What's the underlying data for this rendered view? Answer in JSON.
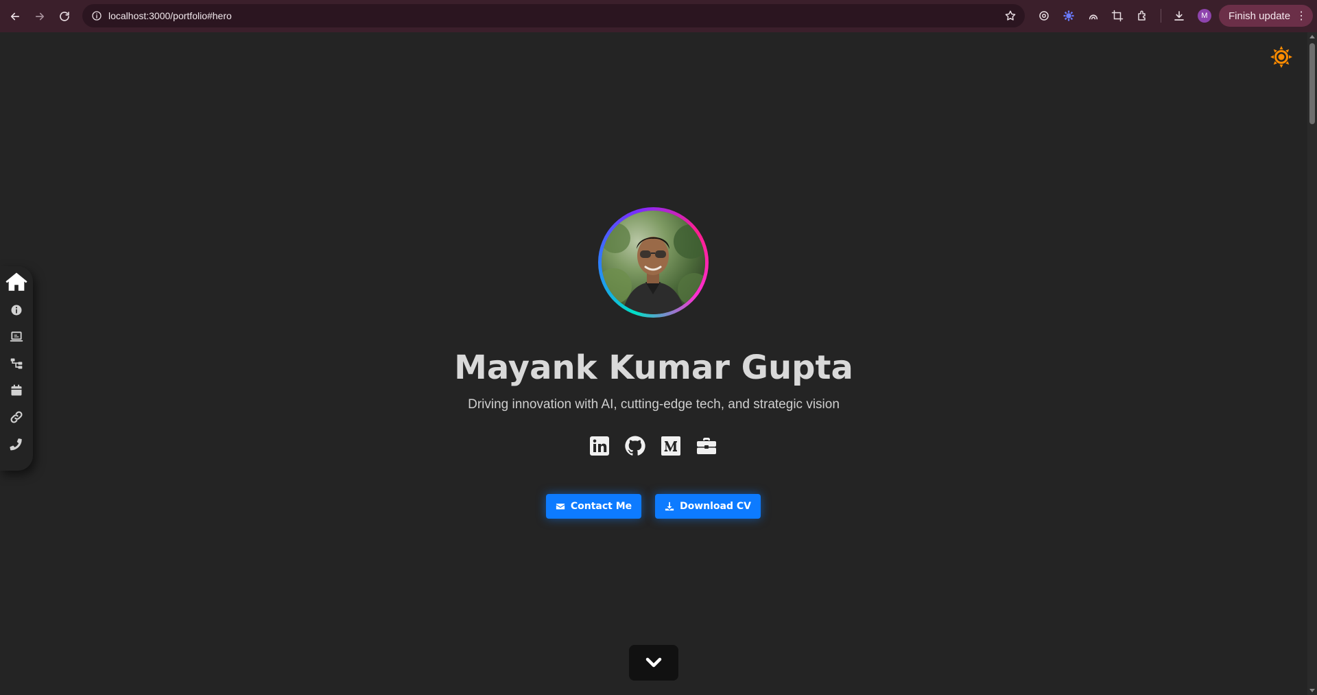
{
  "browser": {
    "url": "localhost:3000/portfolio#hero",
    "profile_initial": "M",
    "finish_update_label": "Finish update",
    "kebab": "⋮"
  },
  "hero": {
    "name": "Mayank Kumar Gupta",
    "tagline": "Driving innovation with AI, cutting-edge tech, and strategic vision"
  },
  "buttons": {
    "contact_label": "Contact Me",
    "download_label": "Download CV"
  },
  "side_nav": {
    "items": [
      {
        "icon": "home-icon"
      },
      {
        "icon": "info-icon"
      },
      {
        "icon": "laptop-icon"
      },
      {
        "icon": "sitemap-icon"
      },
      {
        "icon": "calendar-icon"
      },
      {
        "icon": "link-icon"
      },
      {
        "icon": "phone-icon"
      }
    ]
  },
  "socials": [
    {
      "icon": "linkedin-icon"
    },
    {
      "icon": "github-icon"
    },
    {
      "icon": "medium-icon"
    },
    {
      "icon": "briefcase-icon"
    }
  ],
  "colors": {
    "page_bg": "#242424",
    "chrome_bg": "#3b1f2b",
    "accent_blue": "#0d7bff",
    "theme_toggle": "#ff8c00"
  }
}
